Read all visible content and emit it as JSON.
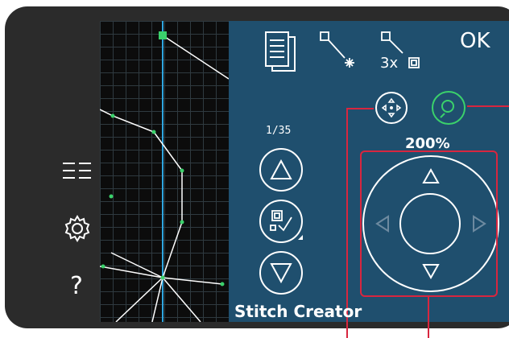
{
  "toolbar": {
    "ok_label": "OK",
    "insert_stitch_icon": "insert-stitch-icon",
    "triple_stitch_label": "3x",
    "pages_icon": "pages-icon"
  },
  "panel": {
    "counter": "1/35",
    "zoom_level": "200%",
    "title": "Stitch Creator"
  },
  "sidebar": {
    "menu_icon": "menu-icon",
    "settings_icon": "gear-icon",
    "help_label": "?"
  },
  "colors": {
    "screen_bg": "#1f4f6e",
    "grid_bg": "#0c0c0c",
    "guide_line": "#2fa6e0",
    "selected_point": "#3bd16b",
    "callout": "#d8263f"
  }
}
